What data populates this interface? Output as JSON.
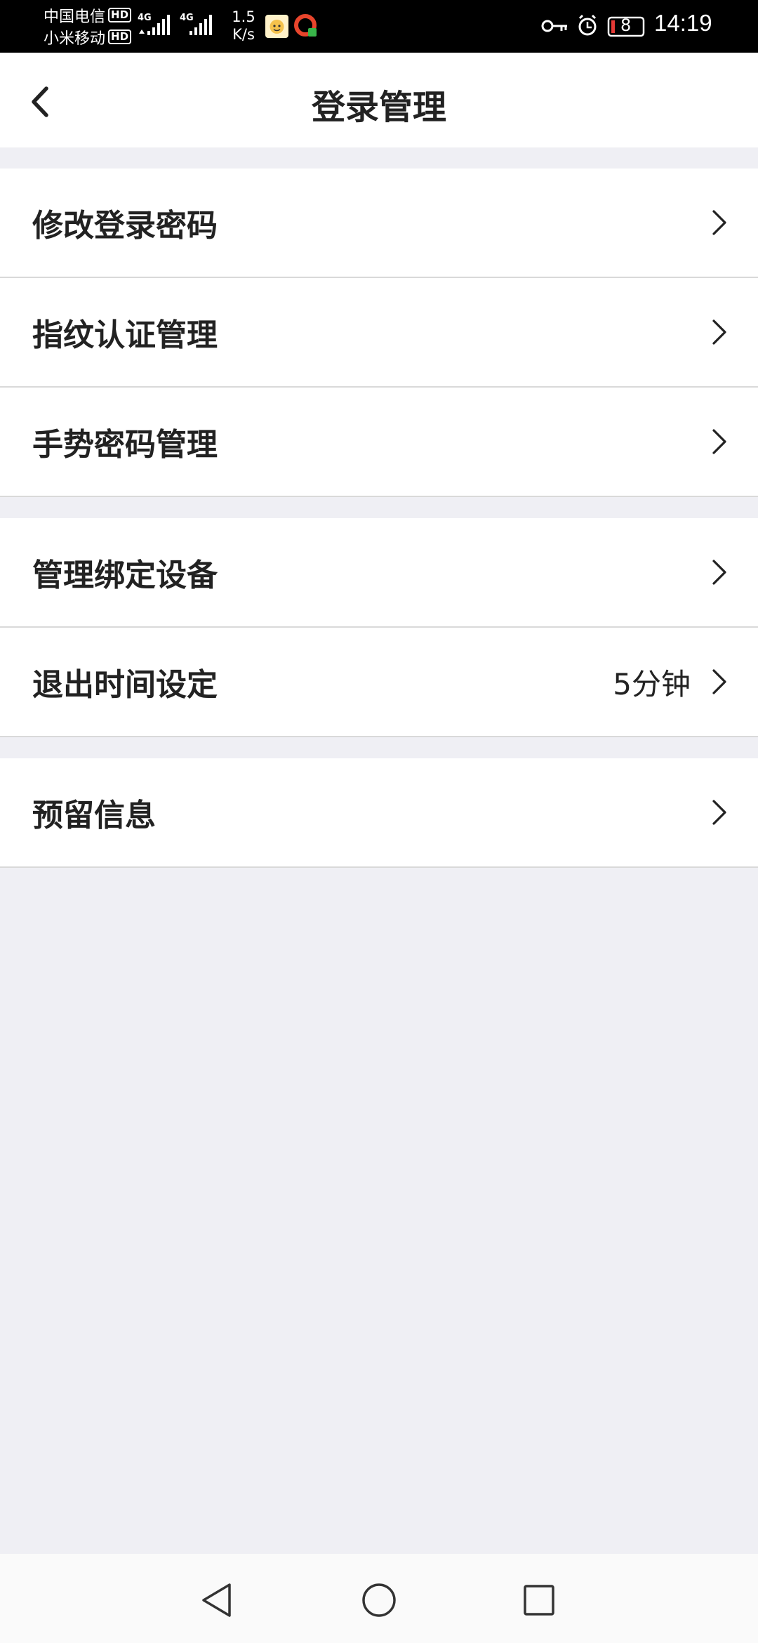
{
  "status_bar": {
    "carrier1": "中国电信",
    "carrier2": "小米移动",
    "hd_badge": "HD",
    "network1": "4G",
    "network2": "4G",
    "speed_value": "1.5",
    "speed_unit": "K/s",
    "battery": "8",
    "time": "14:19"
  },
  "header": {
    "title": "登录管理"
  },
  "groups": [
    {
      "items": [
        {
          "label": "修改登录密码"
        },
        {
          "label": "指纹认证管理"
        },
        {
          "label": "手势密码管理"
        }
      ]
    },
    {
      "items": [
        {
          "label": "管理绑定设备"
        },
        {
          "label": "退出时间设定",
          "value": "5分钟"
        }
      ]
    },
    {
      "items": [
        {
          "label": "预留信息"
        }
      ]
    }
  ],
  "colors": {
    "background": "#efeff4",
    "card": "#ffffff",
    "text": "#222222",
    "divider": "#d9d9d9"
  }
}
